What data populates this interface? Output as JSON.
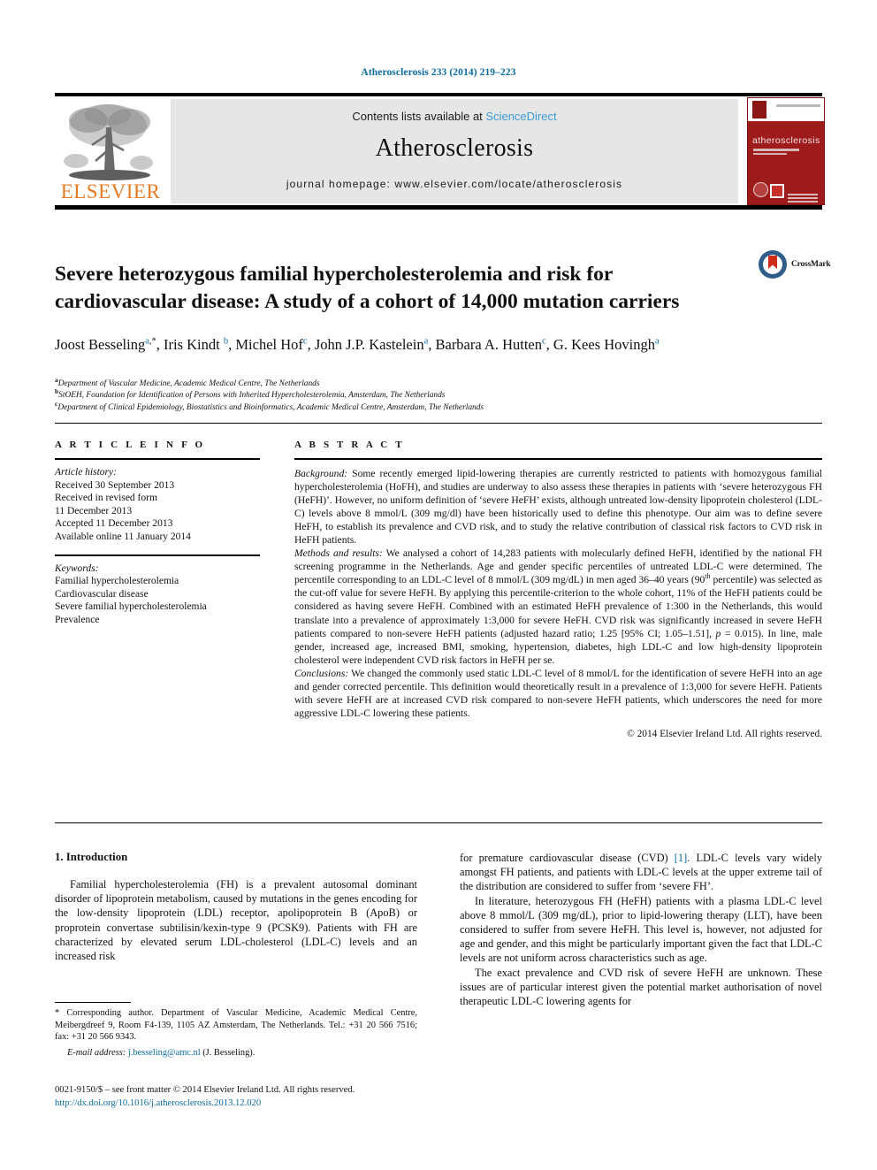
{
  "running_head": "Atherosclerosis 233 (2014) 219–223",
  "header": {
    "contents_prefix": "Contents lists available at ",
    "sciencedirect": "ScienceDirect",
    "journal_name": "Atherosclerosis",
    "homepage": "journal homepage: www.elsevier.com/locate/atherosclerosis",
    "publisher_logo_text": "ELSEVIER",
    "cover_title": "atherosclerosis",
    "accent_link_color": "#3a9bd5",
    "header_band_color": "#e6e6e6",
    "cover_color": "#9e1b1b",
    "elsevier_orange": "#e87a22"
  },
  "crossmark": {
    "label": "CrossMark"
  },
  "article": {
    "title": "Severe heterozygous familial hypercholesterolemia and risk for cardiovascular disease: A study of a cohort of 14,000 mutation carriers",
    "authors_html": "Joost Besseling<sup>a</sup><sup class=\"star\">,*</sup>, Iris Kindt <sup>b</sup>, Michel Hof<sup>c</sup>, John J.P. Kastelein<sup>a</sup>, Barbara A. Hutten<sup>c</sup>, G. Kees Hovingh<sup>a</sup>",
    "affiliations": [
      {
        "marker": "a",
        "text": "Department of Vascular Medicine, Academic Medical Centre, The Netherlands"
      },
      {
        "marker": "b",
        "text": "StOEH, Foundation for Identification of Persons with Inherited Hypercholesterolemia, Amsterdam, The Netherlands"
      },
      {
        "marker": "c",
        "text": "Department of Clinical Epidemiology, Biostatistics and Bioinformatics, Academic Medical Centre, Amsterdam, The Netherlands"
      }
    ]
  },
  "article_info": {
    "heading": "A R T I C L E  I N F O",
    "history_label": "Article history:",
    "history": [
      "Received 30 September 2013",
      "Received in revised form",
      "11 December 2013",
      "Accepted 11 December 2013",
      "Available online 11 January 2014"
    ],
    "keywords_label": "Keywords:",
    "keywords": [
      "Familial hypercholesterolemia",
      "Cardiovascular disease",
      "Severe familial hypercholesterolemia",
      "Prevalence"
    ]
  },
  "abstract": {
    "heading": "A B S T R A C T",
    "background_label": "Background:",
    "background": " Some recently emerged lipid-lowering therapies are currently restricted to patients with homozygous familial hypercholesterolemia (HoFH), and studies are underway to also assess these therapies in patients with ‘severe heterozygous FH (HeFH)’. However, no uniform definition of ‘severe HeFH’ exists, although untreated low-density lipoprotein cholesterol (LDL-C) levels above 8 mmol/L (309 mg/dl) have been historically used to define this phenotype. Our aim was to define severe HeFH, to establish its prevalence and CVD risk, and to study the relative contribution of classical risk factors to CVD risk in HeFH patients.",
    "methods_label": "Methods and results:",
    "methods_part1": "  We analysed a cohort of 14,283 patients with molecularly defined HeFH, identified by the national FH screening programme in the Netherlands. Age and gender specific percentiles of untreated LDL-C were determined. The percentile corresponding to an LDL-C level of 8 mmol/L (309 mg/dL) in men aged 36–40 years (90",
    "methods_sup": "th",
    "methods_part2": " percentile) was selected as the cut-off value for severe HeFH. By applying this percentile-criterion to the whole cohort, 11% of the HeFH patients could be considered as having severe HeFH. Combined with an estimated HeFH prevalence of 1:300 in the Netherlands, this would translate into a prevalence of approximately 1:3,000 for severe HeFH. CVD risk was significantly increased in severe HeFH patients compared to non-severe HeFH patients (adjusted hazard ratio; 1.25 [95% CI; 1.05–1.51], ",
    "methods_p_italic": "p",
    "methods_part3": " = 0.015). In line, male gender, increased age, increased BMI, smoking, hypertension, diabetes, high LDL-C and low high-density lipoprotein cholesterol were independent CVD risk factors in HeFH per se.",
    "conclusions_label": "Conclusions:",
    "conclusions": " We changed the commonly used static LDL-C level of 8 mmol/L for the identification of severe HeFH into an age and gender corrected percentile. This definition would theoretically result in a prevalence of 1:3,000 for severe HeFH. Patients with severe HeFH are at increased CVD risk compared to non-severe HeFH patients, which underscores the need for more aggressive LDL-C lowering these patients.",
    "copyright": "© 2014 Elsevier Ireland Ltd. All rights reserved."
  },
  "introduction": {
    "section_number_title": "1. Introduction",
    "para1_left": "Familial hypercholesterolemia (FH) is a prevalent autosomal dominant disorder of lipoprotein metabolism, caused by mutations in the genes encoding for the low-density lipoprotein (LDL) receptor, apolipoprotein B (ApoB) or proprotein convertase subtilisin/kexin-type 9 (PCSK9). Patients with FH are characterized by elevated serum LDL-cholesterol (LDL-C) levels and an increased risk",
    "para1_right_a": "for premature cardiovascular disease (CVD) ",
    "ref1": "[1]",
    "para1_right_b": ". LDL-C levels vary widely amongst FH patients, and patients with LDL-C levels at the upper extreme tail of the distribution are considered to suffer from ‘severe FH’.",
    "para2_right": "In literature, heterozygous FH (HeFH) patients with a plasma LDL-C level above 8 mmol/L (309 mg/dL), prior to lipid-lowering therapy (LLT), have been considered to suffer from severe HeFH. This level is, however, not adjusted for age and gender, and this might be particularly important given the fact that LDL-C levels are not uniform across characteristics such as age.",
    "para3_right": "The exact prevalence and CVD risk of severe HeFH are unknown. These issues are of particular interest given the potential market authorisation of novel therapeutic LDL-C lowering agents for"
  },
  "footnote": {
    "corresponding": "* Corresponding author. Department of Vascular Medicine, Academic Medical Centre, Meibergdreef 9, Room F4-139, 1105 AZ Amsterdam, The Netherlands. Tel.: +31 20 566 7516; fax: +31 20 566 9343.",
    "email_label": "E-mail address:",
    "email": "j.besseling@amc.nl",
    "email_suffix": " (J. Besseling)."
  },
  "imprint": {
    "line1": "0021-9150/$ – see front matter © 2014 Elsevier Ireland Ltd. All rights reserved.",
    "doi": "http://dx.doi.org/10.1016/j.atherosclerosis.2013.12.020"
  }
}
